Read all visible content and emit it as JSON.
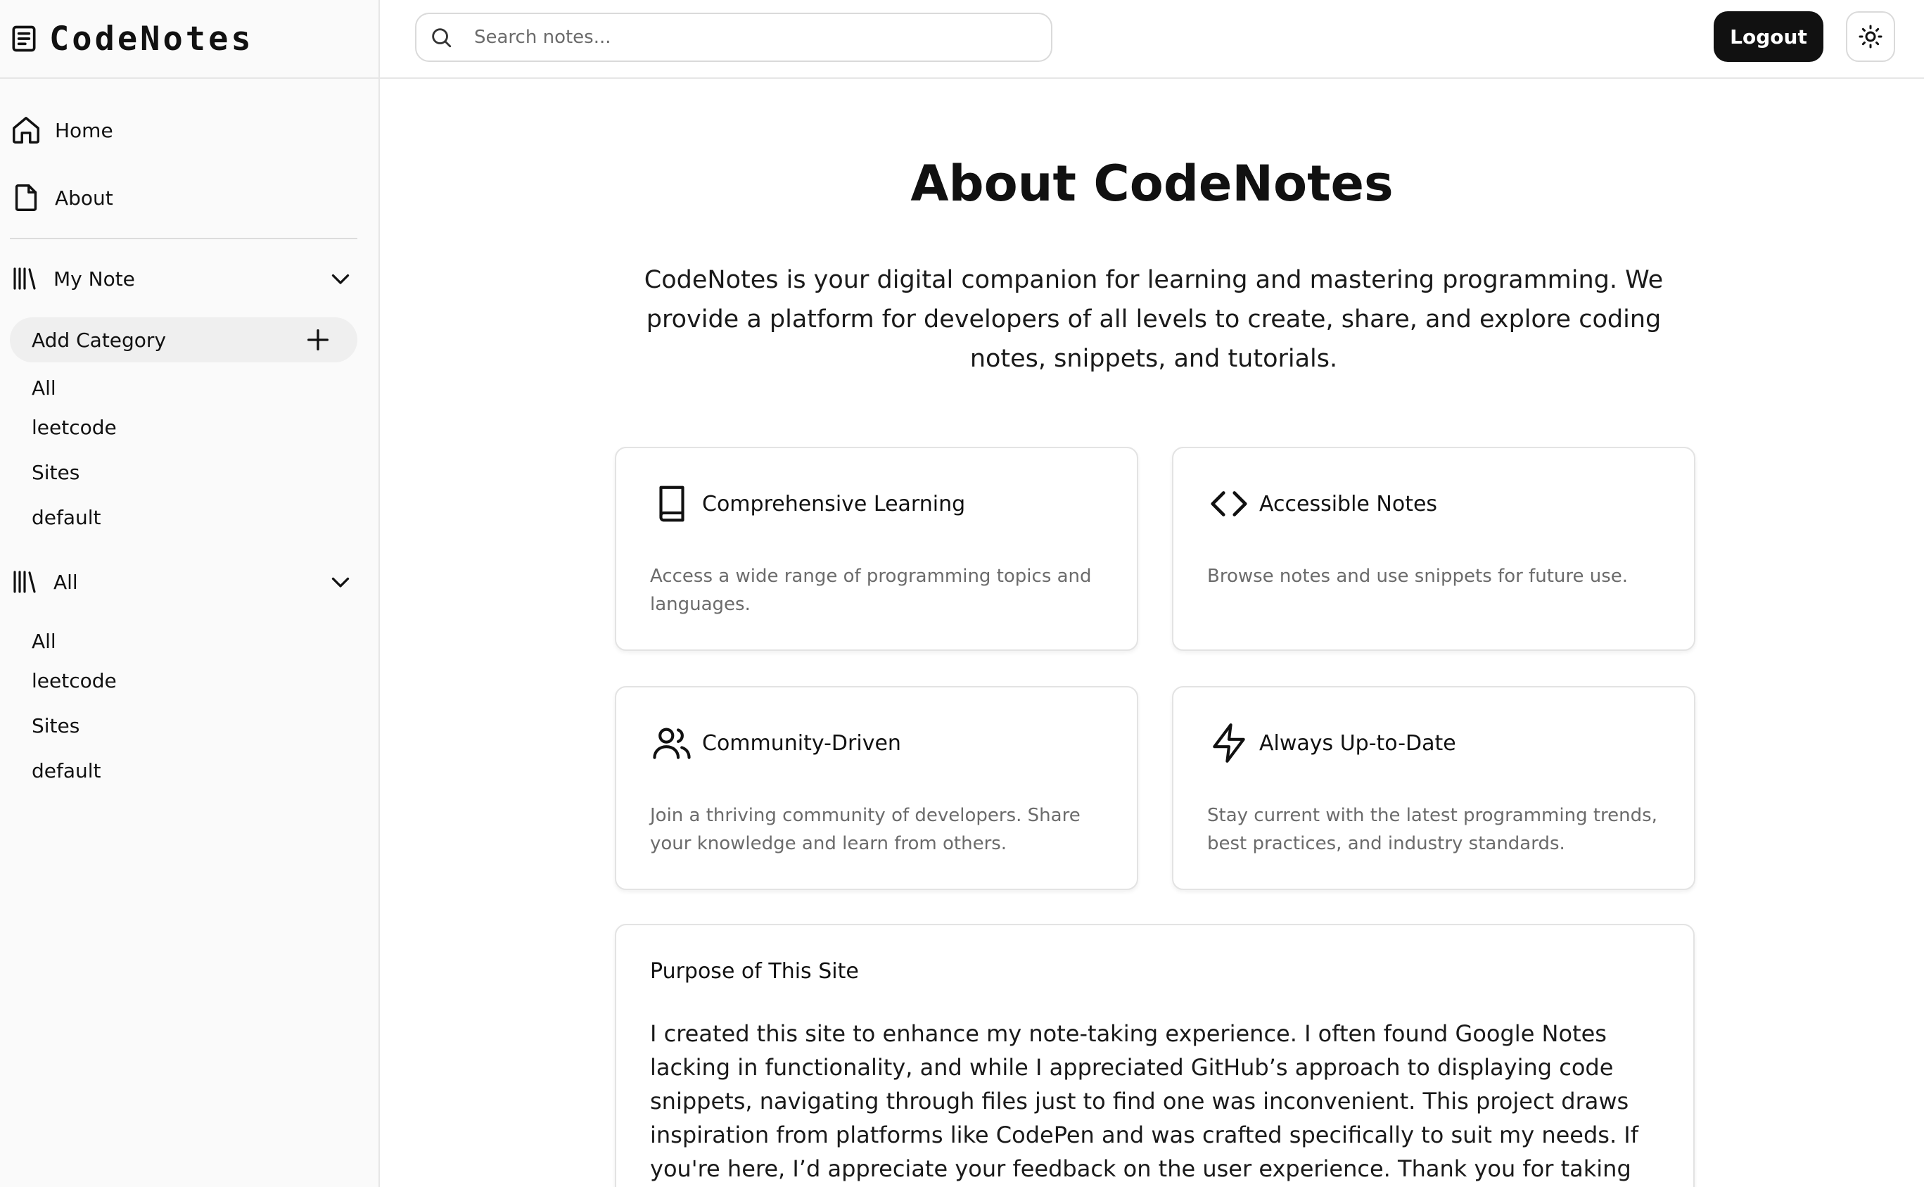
{
  "brand": {
    "name": "CodeNotes",
    "icon": "note-icon"
  },
  "sidebar": {
    "nav": [
      {
        "label": "Home",
        "icon": "home-icon"
      },
      {
        "label": "About",
        "icon": "file-icon"
      }
    ],
    "my_note": {
      "label": "My Note",
      "icon": "library-icon",
      "expanded": true,
      "add_category_label": "Add Category",
      "categories": [
        "All",
        "leetcode",
        "Sites",
        "default"
      ]
    },
    "all_group": {
      "label": "All",
      "icon": "library-icon",
      "expanded": true,
      "categories": [
        "All",
        "leetcode",
        "Sites",
        "default"
      ]
    }
  },
  "header": {
    "search_placeholder": "Search notes...",
    "search_value": "",
    "logout_label": "Logout",
    "theme_icon": "sun-icon"
  },
  "main": {
    "title": "About CodeNotes",
    "intro": "CodeNotes is your digital companion for learning and mastering programming. We provide a platform for developers of all levels to create, share, and explore coding notes, snippets, and tutorials.",
    "features": [
      {
        "icon": "book-icon",
        "title": "Comprehensive Learning",
        "description": "Access a wide range of programming topics and languages."
      },
      {
        "icon": "code-icon",
        "title": "Accessible Notes",
        "description": "Browse notes and use snippets for future use."
      },
      {
        "icon": "users-icon",
        "title": "Community-Driven",
        "description": "Join a thriving community of developers. Share your knowledge and learn from others."
      },
      {
        "icon": "zap-icon",
        "title": "Always Up-to-Date",
        "description": "Stay current with the latest programming trends, best practices, and industry standards."
      }
    ],
    "purpose": {
      "title": "Purpose of This Site",
      "body": "I created this site to enhance my note-taking experience. I often found Google Notes lacking in functionality, and while I appreciated GitHub’s approach to displaying code snippets, navigating through files just to find one was inconvenient. This project draws inspiration from platforms like CodePen and was crafted specifically to suit my needs. If you're here, I’d appreciate your feedback on the user experience. Thank you for taking the time to explore this site! 😊"
    }
  },
  "colors": {
    "accent": "#111111",
    "muted_text": "#6b6b6b",
    "border": "#e3e3e3",
    "sidebar_bg": "#fafafa"
  }
}
